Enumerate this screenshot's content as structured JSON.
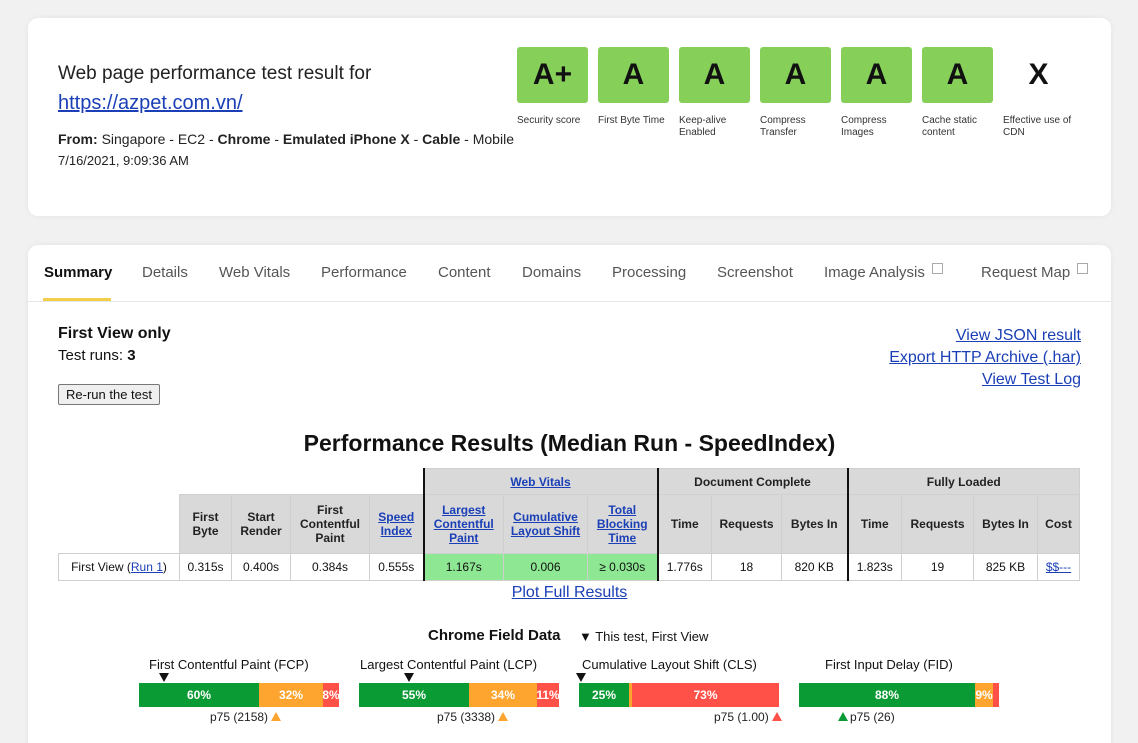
{
  "header": {
    "title": "Web page performance test result for",
    "url": "https://azpet.com.vn/",
    "from_label": "From:",
    "location": "Singapore - EC2",
    "browser": "Chrome",
    "device": "Emulated iPhone X",
    "connection": "Cable",
    "platform": "Mobile",
    "date": "7/16/2021, 9:09:36 AM"
  },
  "grades": [
    {
      "grade": "A+",
      "label": "Security score"
    },
    {
      "grade": "A",
      "label": "First Byte Time"
    },
    {
      "grade": "A",
      "label": "Keep-alive Enabled"
    },
    {
      "grade": "A",
      "label": "Compress Transfer"
    },
    {
      "grade": "A",
      "label": "Compress Images"
    },
    {
      "grade": "A",
      "label": "Cache static content"
    },
    {
      "grade": "X",
      "label": "Effective use of CDN"
    }
  ],
  "tabs": [
    {
      "label": "Summary"
    },
    {
      "label": "Details"
    },
    {
      "label": "Web Vitals"
    },
    {
      "label": "Performance"
    },
    {
      "label": "Content"
    },
    {
      "label": "Domains"
    },
    {
      "label": "Processing"
    },
    {
      "label": "Screenshot"
    },
    {
      "label": "Image Analysis",
      "icon": "external-link-icon"
    },
    {
      "label": "Request Map",
      "icon": "external-link-icon"
    }
  ],
  "summary": {
    "view_label": "First View only",
    "runs_label": "Test runs:",
    "runs_value": "3",
    "rerun_button": "Re-run the test",
    "links": [
      "View JSON result",
      "Export HTTP Archive (.har)",
      "View Test Log"
    ]
  },
  "results": {
    "title": "Performance Results (Median Run - SpeedIndex)",
    "group_headers": {
      "web_vitals": "Web Vitals",
      "document_complete": "Document Complete",
      "fully_loaded": "Fully Loaded"
    },
    "columns": {
      "first_byte": "First Byte",
      "start_render": "Start Render",
      "fcp": "First Contentful Paint",
      "speed_index": "Speed Index",
      "lcp": "Largest Contentful Paint",
      "cls": "Cumulative Layout Shift",
      "tbt": "Total Blocking Time",
      "dc_time": "Time",
      "dc_requests": "Requests",
      "dc_bytes": "Bytes In",
      "fl_time": "Time",
      "fl_requests": "Requests",
      "fl_bytes": "Bytes In",
      "cost": "Cost"
    },
    "row": {
      "label": "First View (",
      "run_link": "Run 1",
      "label_end": ")",
      "first_byte": "0.315s",
      "start_render": "0.400s",
      "fcp": "0.384s",
      "speed_index": "0.555s",
      "lcp": "1.167s",
      "cls": "0.006",
      "tbt": "≥ 0.030s",
      "dc_time": "1.776s",
      "dc_requests": "18",
      "dc_bytes": "820 KB",
      "fl_time": "1.823s",
      "fl_requests": "19",
      "fl_bytes": "825 KB",
      "cost": "$$---"
    },
    "plot_link": "Plot Full Results"
  },
  "field_data": {
    "title": "Chrome Field Data",
    "subtitle": "▼ This test, First View",
    "metrics": [
      {
        "label": "First Contentful Paint (FCP)",
        "good": 60,
        "ni": 32,
        "poor": 8,
        "good_text": "60%",
        "ni_text": "32%",
        "poor_text": "8%",
        "p75": "p75 (2158)",
        "p75_status": "orange"
      },
      {
        "label": "Largest Contentful Paint (LCP)",
        "good": 55,
        "ni": 34,
        "poor": 11,
        "good_text": "55%",
        "ni_text": "34%",
        "poor_text": "11%",
        "p75": "p75 (3338)",
        "p75_status": "orange"
      },
      {
        "label": "Cumulative Layout Shift (CLS)",
        "good": 25,
        "ni": 1.5,
        "poor": 73.5,
        "good_text": "25%",
        "ni_text": "",
        "poor_text": "73%",
        "p75": "p75 (1.00)",
        "p75_status": "red"
      },
      {
        "label": "First Input Delay (FID)",
        "good": 88,
        "ni": 9,
        "poor": 3,
        "good_text": "88%",
        "ni_text": "9%",
        "poor_text": "",
        "p75": "p75 (26)",
        "p75_status": "green"
      }
    ]
  },
  "colors": {
    "grade_green": "#86cf59",
    "good": "#0b9b34",
    "needs_improvement": "#fda52e",
    "poor": "#ff5147",
    "vitals_green": "#8ee893",
    "tab_accent": "#f2cf4a"
  }
}
